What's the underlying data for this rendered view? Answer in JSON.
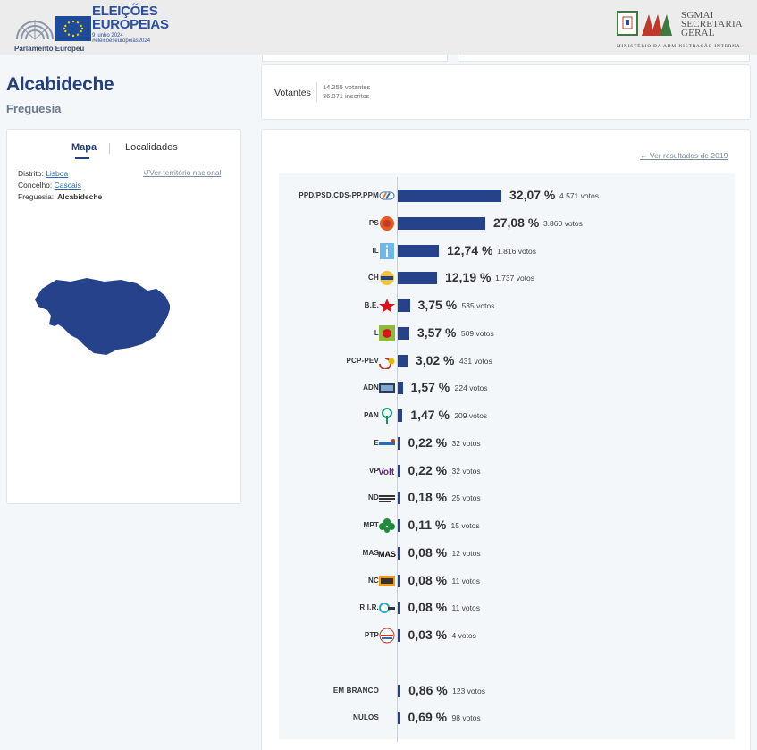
{
  "header": {
    "ep_name": "Parlamento Europeu",
    "elections_title": "ELEIÇÕES EUROPEIAS",
    "elections_date": "9 junho 2024",
    "elections_tag": "#eleicoeseuropeias2024",
    "sgmai_line1": "SGMAI",
    "sgmai_line2": "SECRETARIA",
    "sgmai_line3": "GERAL",
    "ministry": "MINISTÉRIO DA ADMINISTRAÇÃO INTERNA"
  },
  "place": {
    "title": "Alcabideche",
    "subtitle": "Freguesia"
  },
  "map_card": {
    "tab_map": "Mapa",
    "tab_localities": "Localidades",
    "national_link": "Ver território nacional",
    "district_label": "Distrito:",
    "district_value": "Lisboa",
    "county_label": "Concelho:",
    "county_value": "Cascais",
    "parish_label": "Freguesia:",
    "parish_value": "Alcabideche"
  },
  "voters": {
    "label": "Votantes",
    "voters_count": "14.255 votantes",
    "registered_count": "36.071 inscritos"
  },
  "results": {
    "link_2019": "Ver resultados de 2019",
    "bar_color": "#26428b",
    "parties": [
      {
        "name": "PPD/PSD.CDS-PP.PPM",
        "pct": "32,07 %",
        "votes": "4.571 votos",
        "value": 32.07,
        "logo": "ad-logo"
      },
      {
        "name": "PS",
        "pct": "27,08 %",
        "votes": "3.860 votos",
        "value": 27.08,
        "logo": "ps-logo"
      },
      {
        "name": "IL",
        "pct": "12,74 %",
        "votes": "1.816 votos",
        "value": 12.74,
        "logo": "il-logo"
      },
      {
        "name": "CH",
        "pct": "12,19 %",
        "votes": "1.737 votos",
        "value": 12.19,
        "logo": "ch-logo"
      },
      {
        "name": "B.E.",
        "pct": "3,75 %",
        "votes": "535 votos",
        "value": 3.75,
        "logo": "be-logo"
      },
      {
        "name": "L",
        "pct": "3,57 %",
        "votes": "509 votos",
        "value": 3.57,
        "logo": "livre-logo"
      },
      {
        "name": "PCP-PEV",
        "pct": "3,02 %",
        "votes": "431 votos",
        "value": 3.02,
        "logo": "cdu-logo"
      },
      {
        "name": "ADN",
        "pct": "1,57 %",
        "votes": "224 votos",
        "value": 1.57,
        "logo": "adn-logo"
      },
      {
        "name": "PAN",
        "pct": "1,47 %",
        "votes": "209 votos",
        "value": 1.47,
        "logo": "pan-logo"
      },
      {
        "name": "E",
        "pct": "0,22 %",
        "votes": "32 votos",
        "value": 0.22,
        "logo": "ergue-te-logo"
      },
      {
        "name": "VP",
        "pct": "0,22 %",
        "votes": "32 votos",
        "value": 0.22,
        "logo": "volt-logo"
      },
      {
        "name": "ND",
        "pct": "0,18 %",
        "votes": "25 votos",
        "value": 0.18,
        "logo": "nd-logo"
      },
      {
        "name": "MPT",
        "pct": "0,11 %",
        "votes": "15 votos",
        "value": 0.11,
        "logo": "mpt-logo"
      },
      {
        "name": "MAS",
        "pct": "0,08 %",
        "votes": "12 votos",
        "value": 0.08,
        "logo": "mas-logo"
      },
      {
        "name": "NC",
        "pct": "0,08 %",
        "votes": "11 votos",
        "value": 0.08,
        "logo": "nc-logo"
      },
      {
        "name": "R.I.R.",
        "pct": "0,08 %",
        "votes": "11 votos",
        "value": 0.08,
        "logo": "rir-logo"
      },
      {
        "name": "PTP",
        "pct": "0,03 %",
        "votes": "4 votos",
        "value": 0.03,
        "logo": "ptp-logo"
      }
    ],
    "blank": {
      "name": "EM BRANCO",
      "pct": "0,86 %",
      "votes": "123 votos",
      "value": 0.86
    },
    "null": {
      "name": "NULOS",
      "pct": "0,69 %",
      "votes": "98 votos",
      "value": 0.69
    }
  }
}
